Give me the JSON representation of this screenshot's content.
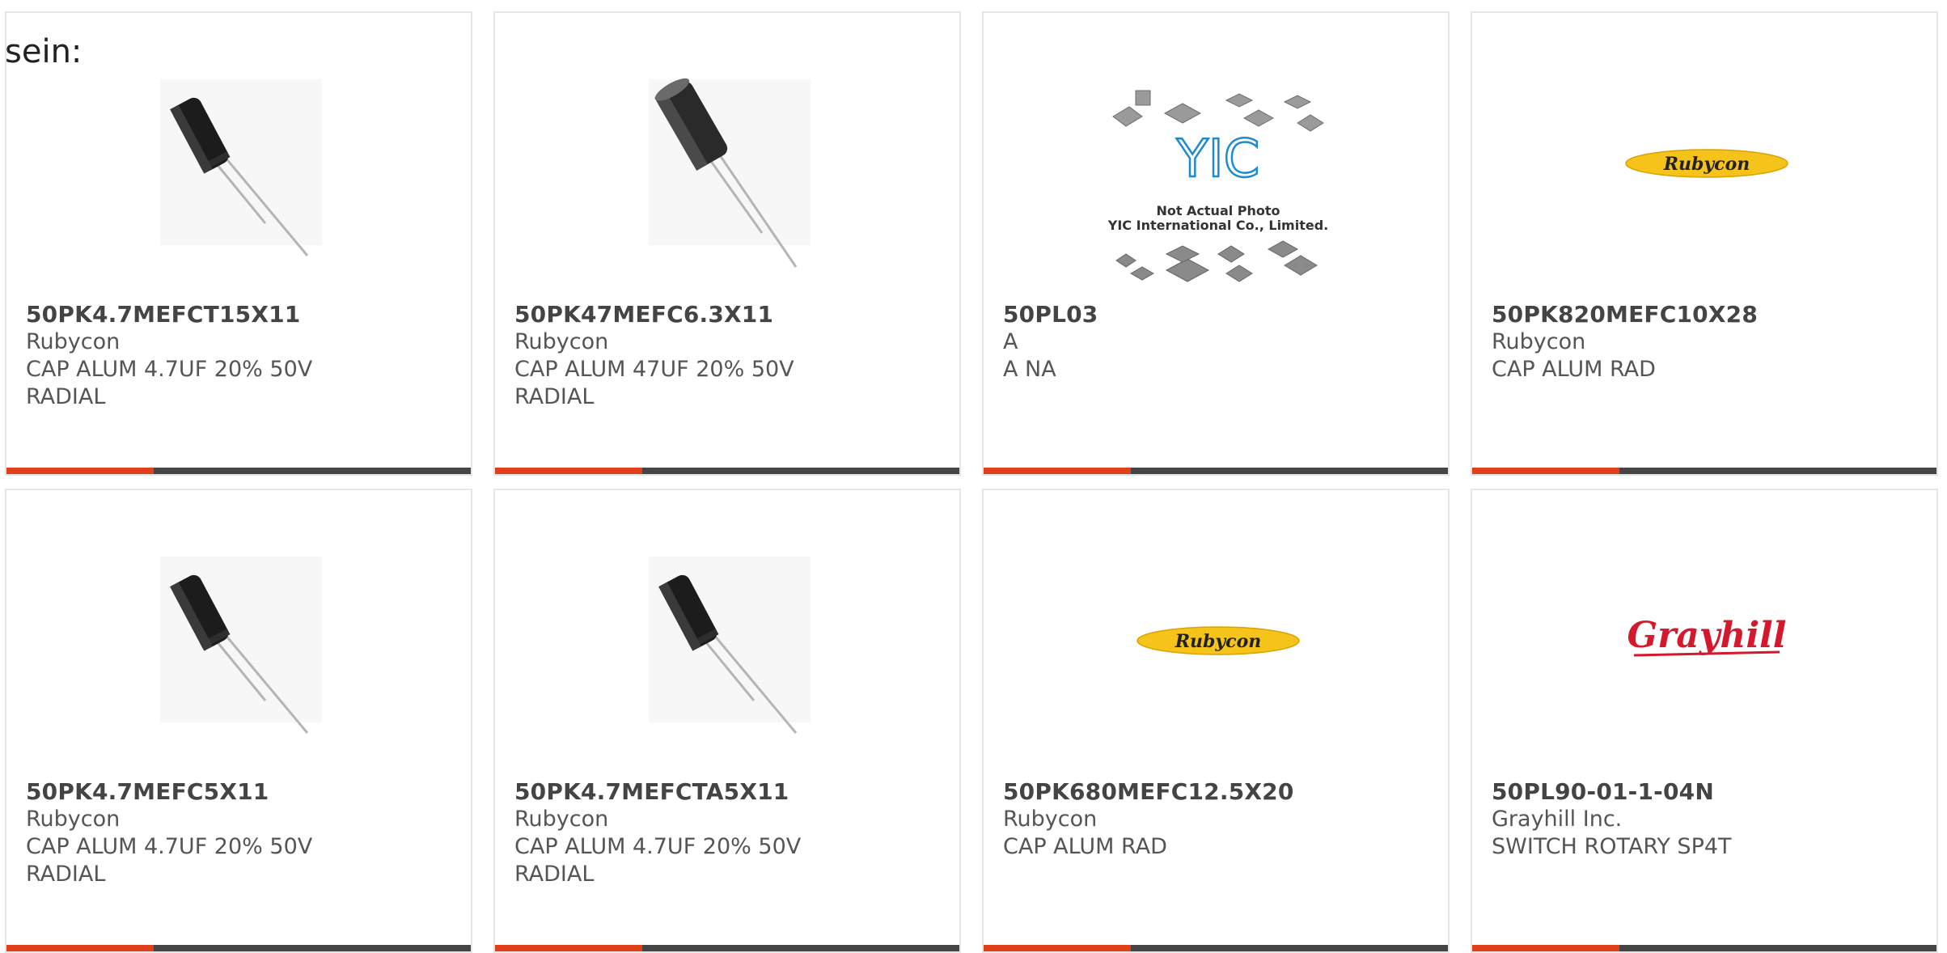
{
  "lead_text": "sein:",
  "accent_color": "#e2401b",
  "bar_color": "#454545",
  "products": [
    {
      "part_number": "50PK4.7MEFCT15X11",
      "manufacturer": "Rubycon",
      "description_line1": "CAP ALUM 4.7UF 20% 50V",
      "description_line2": "RADIAL",
      "image": "capacitor-photo"
    },
    {
      "part_number": "50PK47MEFC6.3X11",
      "manufacturer": "Rubycon",
      "description_line1": "CAP ALUM 47UF 20% 50V",
      "description_line2": "RADIAL",
      "image": "capacitor-photo"
    },
    {
      "part_number": "50PL03",
      "manufacturer": "A",
      "description_line1": "A NA",
      "description_line2": "",
      "image": "not-actual-photo",
      "placeholder_logo": "YIC",
      "placeholder_line1": "Not Actual Photo",
      "placeholder_line2": "YIC International Co., Limited."
    },
    {
      "part_number": "50PK820MEFC10X28",
      "manufacturer": "Rubycon",
      "description_line1": "CAP ALUM RAD",
      "description_line2": "",
      "image": "rubycon-logo",
      "logo_text": "Rubycon"
    },
    {
      "part_number": "50PK4.7MEFC5X11",
      "manufacturer": "Rubycon",
      "description_line1": "CAP ALUM 4.7UF 20% 50V",
      "description_line2": "RADIAL",
      "image": "capacitor-photo"
    },
    {
      "part_number": "50PK4.7MEFCTA5X11",
      "manufacturer": "Rubycon",
      "description_line1": "CAP ALUM 4.7UF 20% 50V",
      "description_line2": "RADIAL",
      "image": "capacitor-photo"
    },
    {
      "part_number": "50PK680MEFC12.5X20",
      "manufacturer": "Rubycon",
      "description_line1": "CAP ALUM RAD",
      "description_line2": "",
      "image": "rubycon-logo",
      "logo_text": "Rubycon"
    },
    {
      "part_number": "50PL90-01-1-04N",
      "manufacturer": "Grayhill Inc.",
      "description_line1": "SWITCH ROTARY SP4T",
      "description_line2": "",
      "image": "grayhill-logo",
      "logo_text": "Grayhill"
    }
  ]
}
